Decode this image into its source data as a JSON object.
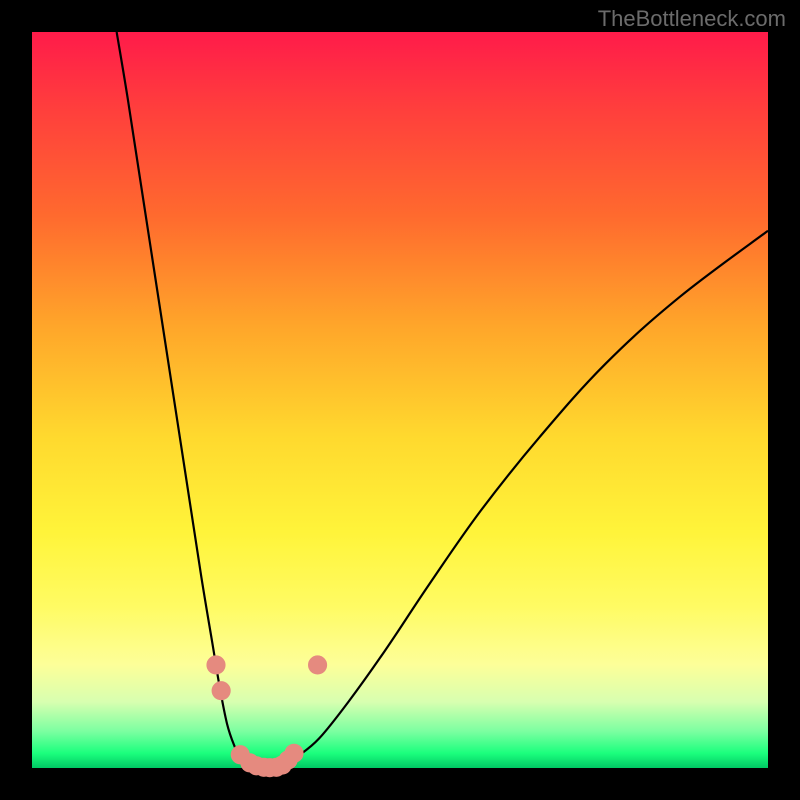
{
  "watermark": "TheBottleneck.com",
  "chart_data": {
    "type": "line",
    "title": "",
    "xlabel": "",
    "ylabel": "",
    "xlim": [
      0,
      100
    ],
    "ylim": [
      0,
      100
    ],
    "background_gradient_stops": [
      {
        "pct": 0,
        "color": "#ff1b4a"
      },
      {
        "pct": 25,
        "color": "#ff6a2e"
      },
      {
        "pct": 55,
        "color": "#ffd92e"
      },
      {
        "pct": 86,
        "color": "#fdff99"
      },
      {
        "pct": 100,
        "color": "#00c864"
      }
    ],
    "series": [
      {
        "name": "left-curve",
        "x": [
          11.5,
          13,
          15,
          17,
          19,
          21,
          23,
          24.5,
          25.5,
          26.5,
          27.5,
          28.5,
          29.5,
          30.5
        ],
        "y": [
          100,
          91,
          78,
          65,
          52,
          39,
          26,
          17,
          11,
          6,
          3,
          1,
          0.3,
          0
        ]
      },
      {
        "name": "right-curve",
        "x": [
          34,
          36,
          39,
          43,
          48,
          54,
          61,
          69,
          78,
          88,
          100
        ],
        "y": [
          0,
          1.5,
          4,
          9,
          16,
          25,
          35,
          45,
          55,
          64,
          73
        ]
      },
      {
        "name": "floor-segment",
        "x": [
          30.5,
          34
        ],
        "y": [
          0,
          0
        ]
      }
    ],
    "markers": [
      {
        "x": 25.0,
        "y": 14.0
      },
      {
        "x": 25.7,
        "y": 10.5
      },
      {
        "x": 28.3,
        "y": 1.8
      },
      {
        "x": 29.6,
        "y": 0.7
      },
      {
        "x": 30.5,
        "y": 0.3
      },
      {
        "x": 31.5,
        "y": 0.1
      },
      {
        "x": 32.3,
        "y": 0.05
      },
      {
        "x": 33.2,
        "y": 0.1
      },
      {
        "x": 34.0,
        "y": 0.4
      },
      {
        "x": 34.8,
        "y": 1.1
      },
      {
        "x": 35.6,
        "y": 2.0
      },
      {
        "x": 38.8,
        "y": 14.0
      }
    ],
    "marker_radius": 1.3,
    "marker_color": "#e58a7f"
  }
}
